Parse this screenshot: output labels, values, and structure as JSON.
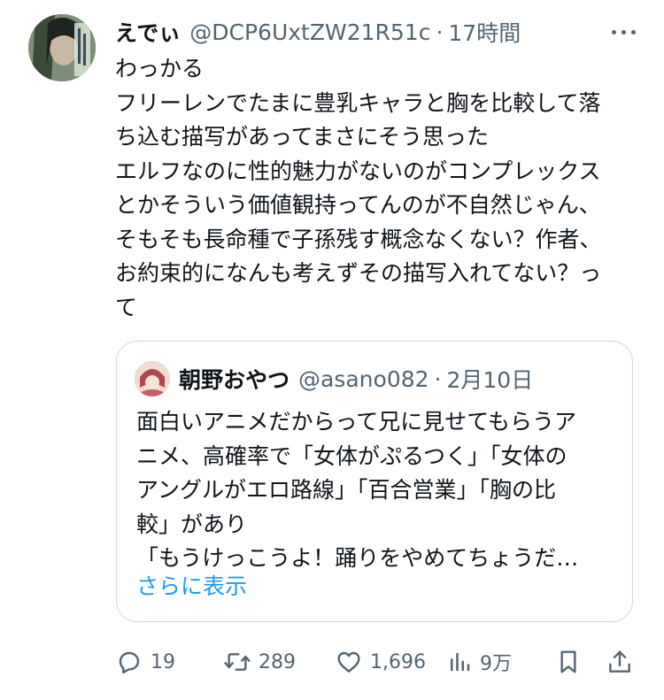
{
  "tweet": {
    "author_name": "えでぃ",
    "handle": "@DCP6UxtZW21R51c",
    "separator": "·",
    "time": "17時間",
    "lines": [
      "わっかる",
      "フリーレンでたまに豊乳キャラと胸を比較して落",
      "ち込む描写があってまさにそう思った",
      "エルフなのに性的魅力がないのがコンプレックス",
      "とかそういう価値観持ってんのが不自然じゃん、",
      "そもそも長命種で子孫残す概念なくない？作者、",
      "お約束的になんも考えずその描写入れてない？っ",
      "て"
    ]
  },
  "quote": {
    "author_name": "朝野おやつ",
    "handle": "@asano082",
    "separator": "·",
    "time": "2月10日",
    "lines": [
      "面白いアニメだからって兄に見せてもらうア",
      "ニメ、高確率で「女体がぷるつく」「女体の",
      "アングルがエロ路線」「百合営業」「胸の比",
      "較」があり",
      "「もうけっこうよ！踊りをやめてちょうだ…"
    ],
    "show_more": "さらに表示"
  },
  "actions": {
    "replies": "19",
    "retweets": "289",
    "likes": "1,696",
    "views": "9万"
  },
  "colors": {
    "text": "#0f1419",
    "secondary": "#536471",
    "link": "#1d9bf0",
    "border": "#cfd9de"
  }
}
